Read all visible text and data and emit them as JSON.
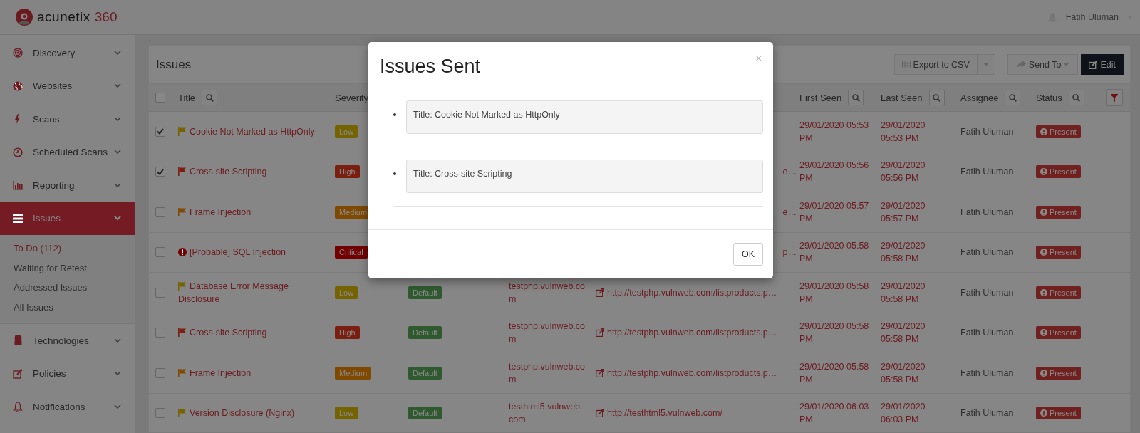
{
  "header": {
    "logo_text": "acunetix",
    "logo_suffix": "360",
    "user": "Fatih Uluman"
  },
  "sidebar": {
    "items": [
      {
        "label": "Discovery",
        "selected": false,
        "expanded": false
      },
      {
        "label": "Websites",
        "selected": false,
        "expanded": false
      },
      {
        "label": "Scans",
        "selected": false,
        "expanded": false
      },
      {
        "label": "Scheduled Scans",
        "selected": false,
        "expanded": false
      },
      {
        "label": "Reporting",
        "selected": false,
        "expanded": false
      },
      {
        "label": "Issues",
        "selected": true,
        "expanded": true,
        "children": [
          {
            "label": "To Do (112)",
            "selected": true
          },
          {
            "label": "Waiting for Retest",
            "selected": false
          },
          {
            "label": "Addressed Issues",
            "selected": false
          },
          {
            "label": "All Issues",
            "selected": false
          }
        ]
      },
      {
        "label": "Technologies",
        "selected": false,
        "expanded": false
      },
      {
        "label": "Policies",
        "selected": false,
        "expanded": false
      },
      {
        "label": "Notifications",
        "selected": false,
        "expanded": false
      }
    ]
  },
  "panel": {
    "title": "Issues",
    "buttons": [
      {
        "kind": "export",
        "label": "Export to CSV"
      },
      {
        "kind": "split-caret"
      },
      {
        "kind": "send",
        "label": "Send To"
      },
      {
        "kind": "edit",
        "label": "Edit"
      }
    ]
  },
  "table": {
    "select_all": {
      "checked": false
    },
    "columns": [
      {
        "label": "Title",
        "search_button": true
      },
      {
        "label": "Severity"
      },
      {
        "label": "First Seen",
        "search_button": true
      },
      {
        "label": "Last Seen",
        "search_button": true
      },
      {
        "label": "Assignee",
        "search_button": true
      },
      {
        "label": "Status",
        "search_button": true
      }
    ],
    "rows": [
      {
        "checked": true,
        "marker": {
          "kind": "flag",
          "color": "#756300"
        },
        "title": "Cookie Not Marked as HttpOnly",
        "severity": {
          "text": "Low",
          "color": "#756300"
        },
        "first_seen": "29/01/2020 05:53 PM",
        "last_seen": "29/01/2020 05:53 PM",
        "assignee": "Fatih Uluman",
        "status": "Present"
      },
      {
        "checked": true,
        "marker": {
          "kind": "flag",
          "color": "#7a1f10"
        },
        "title": "Cross-site Scripting",
        "severity": {
          "text": "High",
          "color": "#7a1f10"
        },
        "url": "e…",
        "first_seen": "29/01/2020 05:56 PM",
        "last_seen": "29/01/2020 05:56 PM",
        "assignee": "Fatih Uluman",
        "status": "Present"
      },
      {
        "checked": false,
        "marker": {
          "kind": "flag",
          "color": "#7f4900"
        },
        "title": "Frame Injection",
        "severity": {
          "text": "Medium",
          "color": "#7f4900"
        },
        "url": "e…",
        "first_seen": "29/01/2020 05:57 PM",
        "last_seen": "29/01/2020 05:57 PM",
        "assignee": "Fatih Uluman",
        "status": "Present"
      },
      {
        "checked": false,
        "marker": {
          "kind": "alert",
          "color": "#720000"
        },
        "title": "[Probable] SQL Injection",
        "severity": {
          "text": "Critical",
          "color": "#720000"
        },
        "url": "p…",
        "first_seen": "29/01/2020 05:58 PM",
        "last_seen": "29/01/2020 05:58 PM",
        "assignee": "Fatih Uluman",
        "status": "Present"
      },
      {
        "checked": false,
        "marker": {
          "kind": "flag",
          "color": "#756300"
        },
        "title": "Database Error Message Disclosure",
        "severity": {
          "text": "Low",
          "color": "#756300"
        },
        "group": "Default",
        "website": "testphp.vulnweb.com",
        "url": "http://testphp.vulnweb.com/listproducts.p…",
        "first_seen": "29/01/2020 05:58 PM",
        "last_seen": "29/01/2020 05:58 PM",
        "assignee": "Fatih Uluman",
        "status": "Present"
      },
      {
        "checked": false,
        "marker": {
          "kind": "flag",
          "color": "#7a1f10"
        },
        "title": "Cross-site Scripting",
        "severity": {
          "text": "High",
          "color": "#7a1f10"
        },
        "group": "Default",
        "website": "testphp.vulnweb.com",
        "url": "http://testphp.vulnweb.com/listproducts.p…",
        "first_seen": "29/01/2020 05:58 PM",
        "last_seen": "29/01/2020 05:58 PM",
        "assignee": "Fatih Uluman",
        "status": "Present"
      },
      {
        "checked": false,
        "marker": {
          "kind": "flag",
          "color": "#7f4900"
        },
        "title": "Frame Injection",
        "severity": {
          "text": "Medium",
          "color": "#7f4900"
        },
        "group": "Default",
        "website": "testphp.vulnweb.com",
        "url": "http://testphp.vulnweb.com/listproducts.p…",
        "first_seen": "29/01/2020 05:58 PM",
        "last_seen": "29/01/2020 05:58 PM",
        "assignee": "Fatih Uluman",
        "status": "Present"
      },
      {
        "checked": false,
        "marker": {
          "kind": "flag",
          "color": "#756300"
        },
        "title": "Version Disclosure (Nginx)",
        "severity": {
          "text": "Low",
          "color": "#756300"
        },
        "group": "Default",
        "website": "testhtml5.vulnweb.com",
        "url": "http://testhtml5.vulnweb.com/",
        "first_seen": "29/01/2020 06:03 PM",
        "last_seen": "29/01/2020 06:03 PM",
        "assignee": "Fatih Uluman",
        "status": "Present"
      }
    ]
  },
  "modal": {
    "title": "Issues Sent",
    "close": "×",
    "items": [
      "Title: Cookie Not Marked as HttpOnly",
      "Title: Cross-site Scripting"
    ],
    "button": "OK"
  }
}
